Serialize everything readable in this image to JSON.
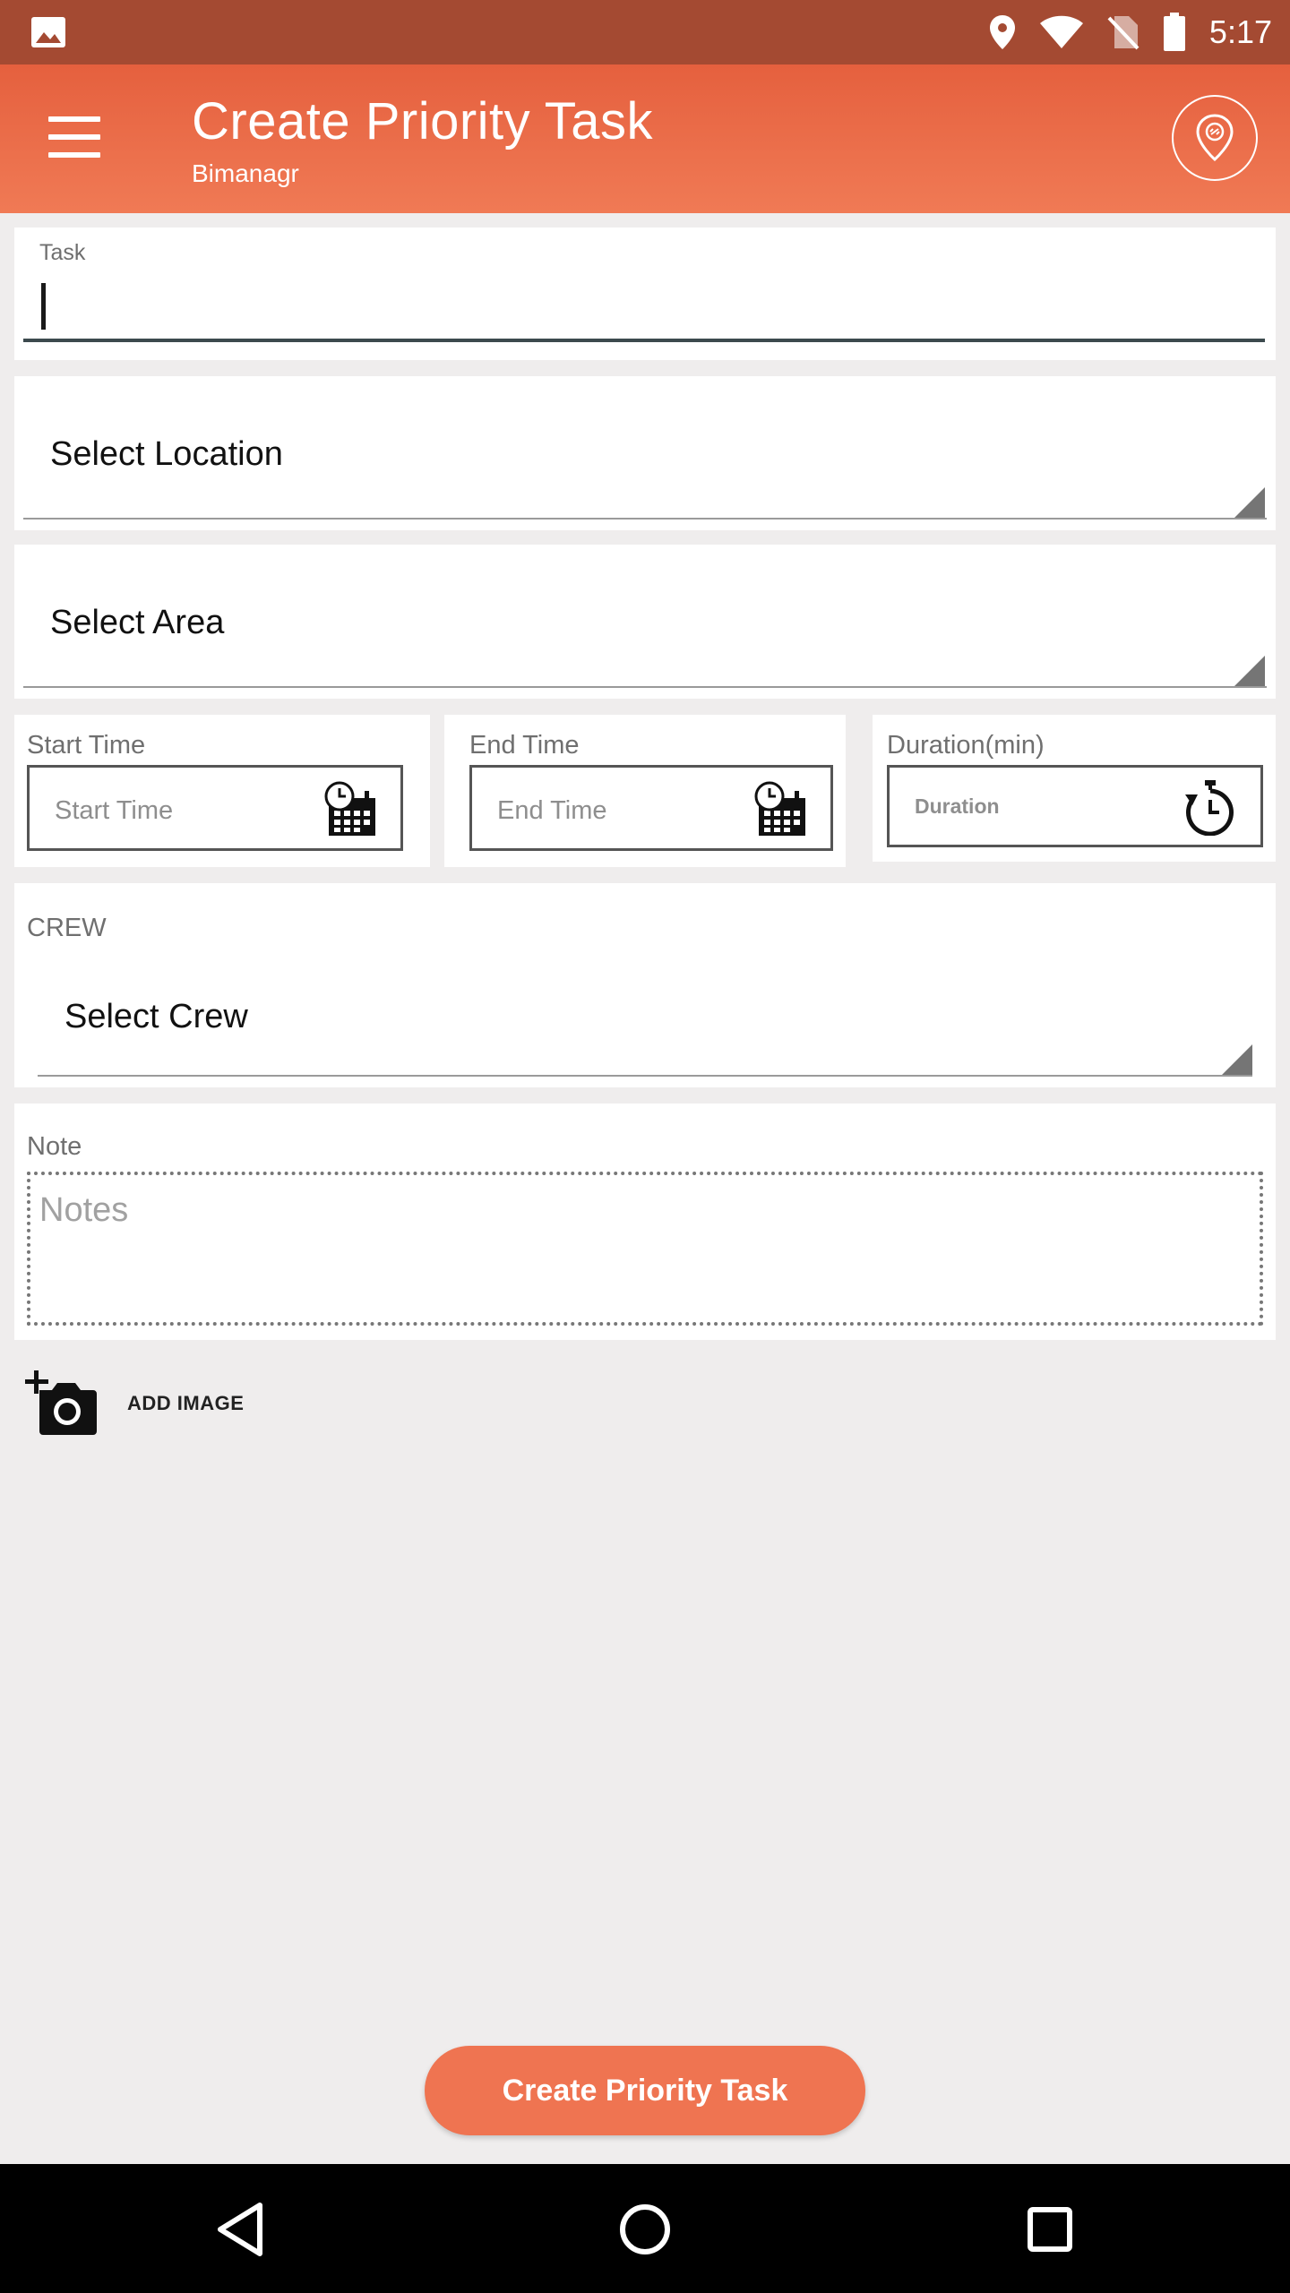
{
  "status_bar": {
    "time": "5:17",
    "icons": [
      "gallery-icon",
      "location-pin-icon",
      "wifi-icon",
      "no-sim-icon",
      "battery-icon"
    ]
  },
  "app_bar": {
    "title": "Create Priority Task",
    "subtitle": "Bimanagr",
    "menu_icon": "hamburger-menu-icon",
    "location_icon": "map-pin-icon"
  },
  "form": {
    "task": {
      "label": "Task",
      "value": ""
    },
    "location": {
      "selected": "Select Location"
    },
    "area": {
      "selected": "Select Area"
    },
    "start_time": {
      "label": "Start Time",
      "placeholder": "Start Time",
      "icon": "calendar-clock-icon"
    },
    "end_time": {
      "label": "End Time",
      "placeholder": "End Time",
      "icon": "calendar-clock-icon"
    },
    "duration": {
      "label": "Duration(min)",
      "placeholder": "Duration",
      "icon": "stopwatch-icon"
    },
    "crew": {
      "label": "CREW",
      "selected": "Select Crew"
    },
    "note": {
      "label": "Note",
      "placeholder": "Notes"
    },
    "add_image": {
      "label": "ADD IMAGE",
      "icon": "add-camera-icon"
    }
  },
  "actions": {
    "create_label": "Create Priority Task"
  },
  "colors": {
    "status_bar": "#a44a32",
    "app_bar_top": "#e5603e",
    "app_bar_bottom": "#f07a55",
    "button": "#ef7451",
    "background": "#efeded"
  }
}
